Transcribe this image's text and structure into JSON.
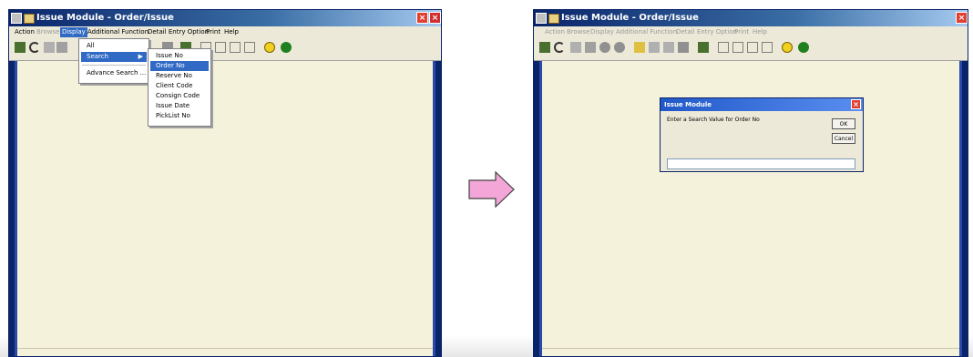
{
  "left_window": {
    "title": "Issue Module - Order/Issue",
    "close": "×",
    "menu": [
      {
        "label": "Action",
        "state": "normal"
      },
      {
        "label": "Browse",
        "state": "dim"
      },
      {
        "label": "Display",
        "state": "active"
      },
      {
        "label": "Additional Function",
        "state": "normal"
      },
      {
        "label": "Detail Entry Option",
        "state": "normal"
      },
      {
        "label": "Print",
        "state": "normal"
      },
      {
        "label": "Help",
        "state": "normal"
      }
    ],
    "display_menu": {
      "items": [
        "All",
        "Search",
        "Advance Search ..."
      ],
      "selected": "Search",
      "submenu_arrow": "▶"
    },
    "search_submenu": {
      "items": [
        "Issue No",
        "Order No",
        "Reserve No",
        "Client Code",
        "Consign Code",
        "Issue Date",
        "PickList No"
      ],
      "selected": "Order No"
    }
  },
  "right_window": {
    "title": "Issue Module - Order/Issue",
    "close": "×",
    "menu": [
      {
        "label": "Action",
        "state": "dim"
      },
      {
        "label": "Browse",
        "state": "dim"
      },
      {
        "label": "Display",
        "state": "dim"
      },
      {
        "label": "Additional Function",
        "state": "dim"
      },
      {
        "label": "Detail Entry Option",
        "state": "dim"
      },
      {
        "label": "Print",
        "state": "dim"
      },
      {
        "label": "Help",
        "state": "dim"
      }
    ],
    "dialog": {
      "title": "Issue Module",
      "close": "×",
      "prompt": "Enter a Search Value for Order No",
      "ok": "OK",
      "cancel": "Cancel",
      "input_value": ""
    }
  },
  "colors": {
    "arrow_fill": "#f5a6d8",
    "arrow_stroke": "#404040",
    "highlight": "#316ac5"
  }
}
